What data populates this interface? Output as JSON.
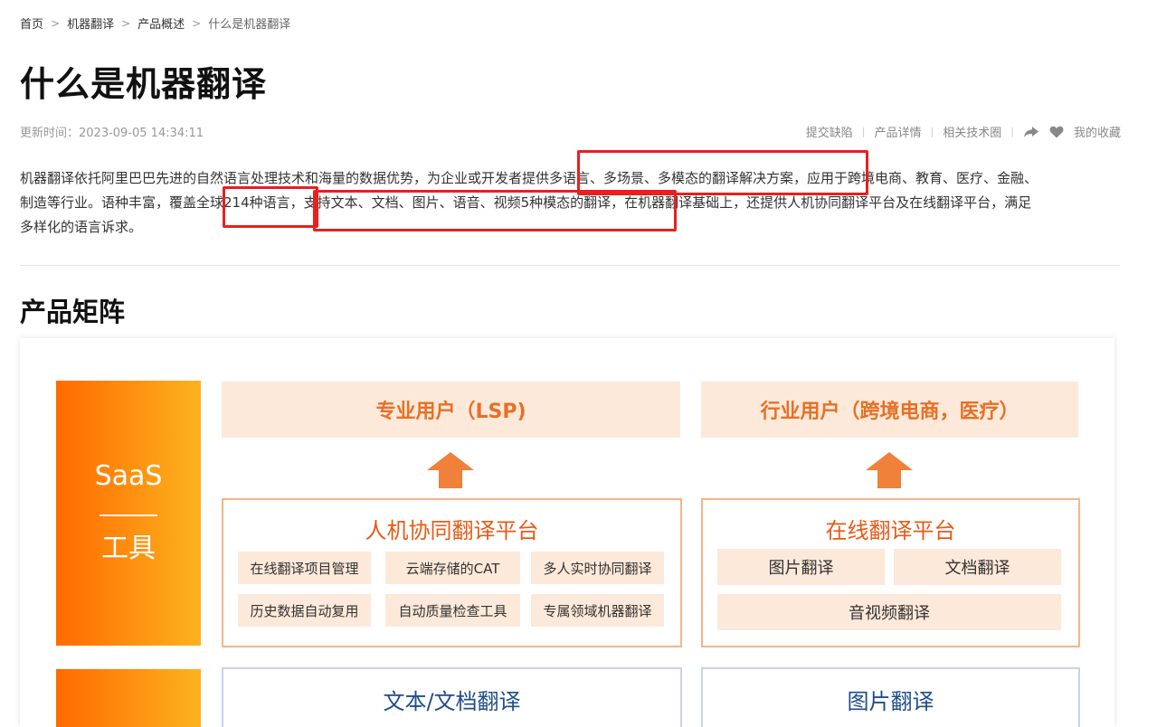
{
  "breadcrumb": [
    "首页",
    "机器翻译",
    "产品概述",
    "什么是机器翻译"
  ],
  "page_title": "什么是机器翻译",
  "meta": {
    "update_label": "更新时间：2023-09-05 14:34:11"
  },
  "toolbar": {
    "feedback": "提交缺陷",
    "product_detail": "产品详情",
    "tech_circle": "相关技术圈",
    "favorites": "我的收藏",
    "share_icon": "share-icon",
    "heart_icon": "heart-icon"
  },
  "intro": {
    "p1": "机器翻译依托阿里巴巴先进的自然语言处理技术和海量的数据优势，为企业或开发者提供多语言、多场景、多模态的翻译解决方案，应用于跨境电商、教育、医疗、金融、",
    "p2": "制造等行业。语种丰富，覆盖全球214种语言，支持文本、文档、图片、语音、视频5种模态的翻译，在机器翻译基础上，还提供人机协同翻译平台及在线翻译平台，满足",
    "p3": "多样化的语言诉求。"
  },
  "section_title": "产品矩阵",
  "diagram": {
    "saas_label": "SaaS",
    "saas_sub": "工具",
    "lsp_user": "专业用户（LSP)",
    "industry_user": "行业用户（跨境电商，医疗）",
    "hmt_platform": {
      "title": "人机协同翻译平台",
      "items": [
        "在线翻译项目管理",
        "云端存储的CAT",
        "多人实时协同翻译",
        "历史数据自动复用",
        "自动质量检查工具",
        "专属领域机器翻译"
      ]
    },
    "online_platform": {
      "title": "在线翻译平台",
      "items": [
        "图片翻译",
        "文档翻译",
        "音视频翻译"
      ]
    },
    "text_doc": "文本/文档翻译",
    "image_trans": "图片翻译"
  }
}
